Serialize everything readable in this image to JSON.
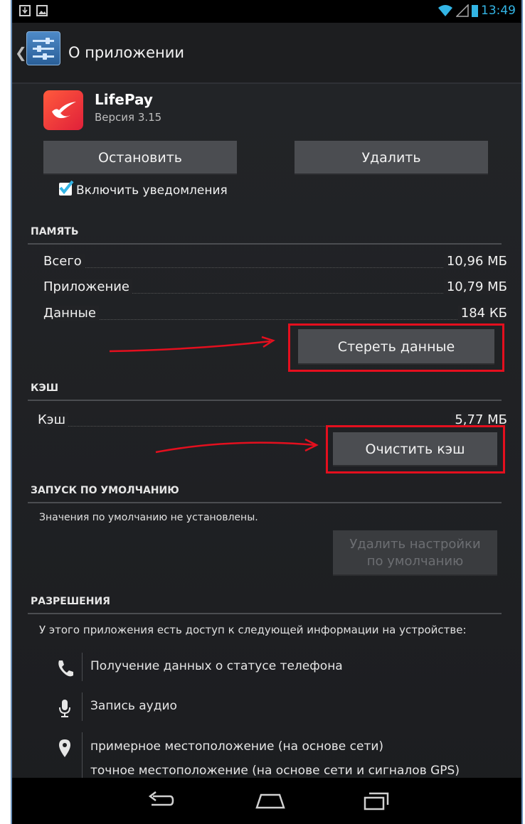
{
  "status_bar": {
    "time": "13:49",
    "icons": [
      "download-icon",
      "image-icon",
      "wifi-icon",
      "signal-icon",
      "battery-icon"
    ]
  },
  "action_bar": {
    "title": "О приложении",
    "icon": "settings-sliders-icon"
  },
  "app": {
    "name": "LifePay",
    "version": "Версия 3.15",
    "icon": "lifepay-app-icon"
  },
  "buttons": {
    "stop": "Остановить",
    "uninstall": "Удалить",
    "clear_data": "Стереть данные",
    "clear_cache": "Очистить кэш",
    "clear_defaults_line1": "Удалить настройки",
    "clear_defaults_line2": "по умолчанию"
  },
  "notifications": {
    "label": "Включить уведомления",
    "checked": true
  },
  "storage": {
    "header": "ПАМЯТЬ",
    "rows": [
      {
        "label": "Всего",
        "value": "10,96 МБ"
      },
      {
        "label": "Приложение",
        "value": "10,79 МБ"
      },
      {
        "label": "Данные",
        "value": "184 КБ"
      }
    ]
  },
  "cache": {
    "header": "КЭШ",
    "label": "Кэш",
    "value": "5,77 МБ"
  },
  "launch_default": {
    "header": "ЗАПУСК ПО УМОЛЧАНИЮ",
    "text": "Значения по умолчанию не установлены."
  },
  "permissions": {
    "header": "РАЗРЕШЕНИЯ",
    "intro": "У этого приложения есть доступ к следующей информации на устройстве:",
    "items": [
      {
        "icon": "phone-icon",
        "lines": [
          "Получение данных о статусе телефона"
        ]
      },
      {
        "icon": "microphone-icon",
        "lines": [
          "Запись аудио"
        ]
      },
      {
        "icon": "location-pin-icon",
        "lines": [
          "примерное местоположение (на основе сети)",
          "точное местоположение (на основе сети и сигналов GPS)"
        ]
      }
    ]
  },
  "nav_bar": {
    "icons": [
      "back-icon",
      "home-icon",
      "recent-apps-icon"
    ]
  },
  "colors": {
    "accent": "#33b5e5",
    "highlight": "#e40f1e",
    "button": "#4b4d51",
    "background": "#1e1f22"
  }
}
